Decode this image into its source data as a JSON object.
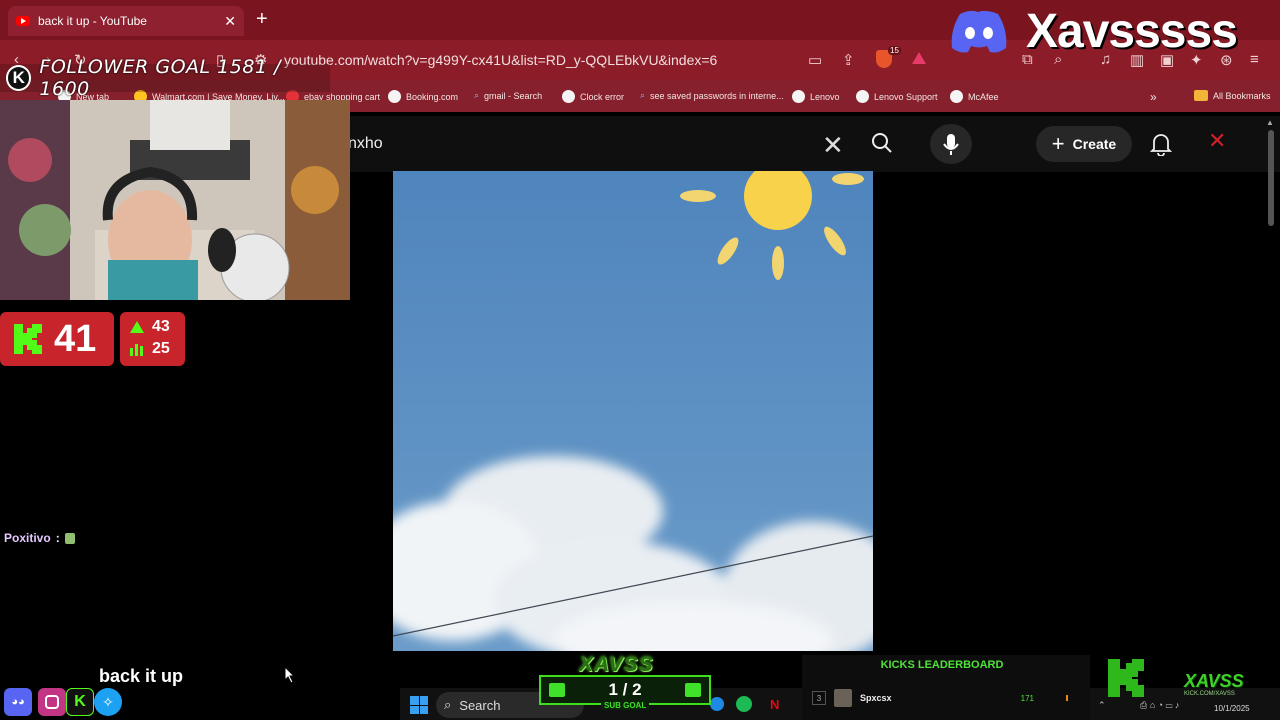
{
  "browser": {
    "tab_title": "back it up - YouTube",
    "new_tab": "+",
    "url": "youtube.com/watch?v=g499Y-cx41U&list=RD_y-QQLEbkVU&index=6",
    "bookmarks": [
      "New tab",
      "Walmart.com | Save Money. Liv...",
      "ebay shopping cart",
      "Booking.com",
      "gmail - Search",
      "Clock error",
      "see saved passwords in interne...",
      "Lenovo",
      "Lenovo Support",
      "McAfee"
    ],
    "all_bookmarks": "All Bookmarks",
    "brave_badge": "15"
  },
  "youtube": {
    "search_value": "nxho",
    "create_label": "Create"
  },
  "overlay": {
    "follower_goal": "FOLLOWER GOAL 1581 / 1600",
    "kick_count": "41",
    "stat_up": "43",
    "stat_bars": "25",
    "chat": {
      "user": "Poxitivo",
      "sep": ":"
    },
    "streamer_name": "Xavsssss",
    "song": "back it up",
    "sub_goal_logo": "XAVSS",
    "sub_goal_count": "1 / 2",
    "sub_goal_label": "SUB GOAL",
    "leaderboard": {
      "title": "KICKS LEADERBOARD",
      "rows": [
        {
          "rank": "3",
          "name": "Spxcsx",
          "score": "171"
        }
      ]
    },
    "brand_small": "XAVSS",
    "brand_small_sub": "KICK.COM/XAVSS"
  },
  "taskbar": {
    "search": "Search",
    "date": "10/1/2025"
  },
  "colors": {
    "tab_bar": "#7a1520",
    "address_bar": "#8c1c28",
    "kick_red": "#c8242c",
    "kick_green": "#3fe12a",
    "sky": "#5c8fc2"
  }
}
